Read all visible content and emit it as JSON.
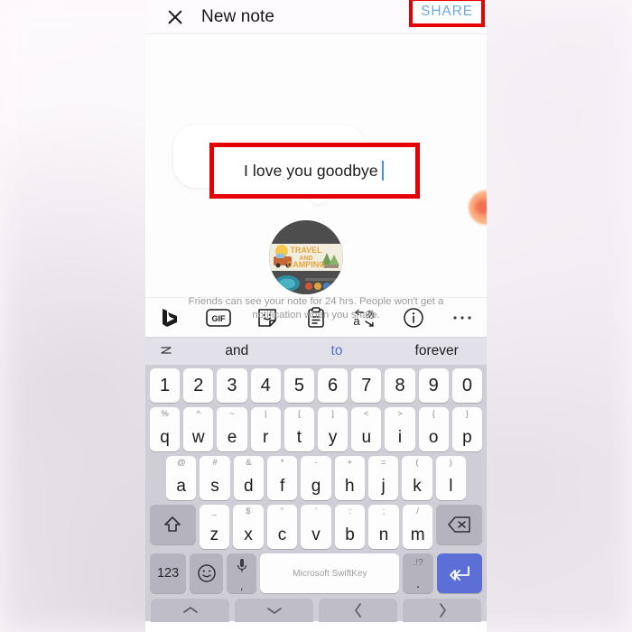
{
  "topbar": {
    "close_icon": "close-icon",
    "title": "New note",
    "share_label": "SHARE"
  },
  "note": {
    "text": "I love you goodbye",
    "caption": "Friends can see your note for 24 hrs. People won't get a notification when you share.",
    "avatar_line1": "TRAVEL",
    "avatar_line2": "AND",
    "avatar_line3": "CAMPING"
  },
  "toolbar": {
    "items": [
      {
        "name": "bing-icon",
        "label": "b"
      },
      {
        "name": "gif-icon",
        "label": "GIF"
      },
      {
        "name": "sticker-icon",
        "label": ""
      },
      {
        "name": "clipboard-icon",
        "label": ""
      },
      {
        "name": "translate-icon",
        "label": ""
      },
      {
        "name": "info-icon",
        "label": "i"
      },
      {
        "name": "more-icon",
        "label": "⋯"
      }
    ]
  },
  "predictions": {
    "left_icon": "clipboard-toggle-icon",
    "items": [
      {
        "label": "and",
        "accent": false
      },
      {
        "label": "to",
        "accent": true
      },
      {
        "label": "forever",
        "accent": false
      }
    ]
  },
  "keyboard": {
    "numbers": [
      "1",
      "2",
      "3",
      "4",
      "5",
      "6",
      "7",
      "8",
      "9",
      "0"
    ],
    "row1": [
      {
        "sup": "%",
        "main": "q"
      },
      {
        "sup": "^",
        "main": "w"
      },
      {
        "sup": "~",
        "main": "e"
      },
      {
        "sup": "|",
        "main": "r"
      },
      {
        "sup": "[",
        "main": "t"
      },
      {
        "sup": "]",
        "main": "y"
      },
      {
        "sup": "<",
        "main": "u"
      },
      {
        "sup": ">",
        "main": "i"
      },
      {
        "sup": "{",
        "main": "o"
      },
      {
        "sup": "}",
        "main": "p"
      }
    ],
    "row2": [
      {
        "sup": "@",
        "main": "a"
      },
      {
        "sup": "#",
        "main": "s"
      },
      {
        "sup": "&",
        "main": "d"
      },
      {
        "sup": "*",
        "main": "f"
      },
      {
        "sup": "-",
        "main": "g"
      },
      {
        "sup": "+",
        "main": "h"
      },
      {
        "sup": "=",
        "main": "j"
      },
      {
        "sup": "(",
        "main": "k"
      },
      {
        "sup": ")",
        "main": "l"
      }
    ],
    "row3": [
      {
        "sup": "_",
        "main": "z"
      },
      {
        "sup": "$",
        "main": "x"
      },
      {
        "sup": "”",
        "main": "c"
      },
      {
        "sup": "’",
        "main": "v"
      },
      {
        "sup": ":",
        "main": "b"
      },
      {
        "sup": ";",
        "main": "n"
      },
      {
        "sup": "/",
        "main": "m"
      }
    ],
    "shift_icon": "shift-icon",
    "backspace_icon": "backspace-icon",
    "numeric_label": "123",
    "emoji_icon": "emoji-icon",
    "mic_icon": "microphone-icon",
    "mic_sub": ",",
    "space_label": "Microsoft SwiftKey",
    "period_sup": ".!?",
    "period_main": ".",
    "enter_icon": "enter-icon",
    "nav": [
      "up-chevron-icon",
      "down-chevron-icon",
      "left-chevron-icon",
      "right-chevron-icon"
    ]
  },
  "colors": {
    "share_blue": "#6fa8dc",
    "highlight_red": "#e60000",
    "caret_blue": "#4a90e2",
    "accent_prediction": "#5a6fd0",
    "enter_blue": "#5b6fd6"
  }
}
